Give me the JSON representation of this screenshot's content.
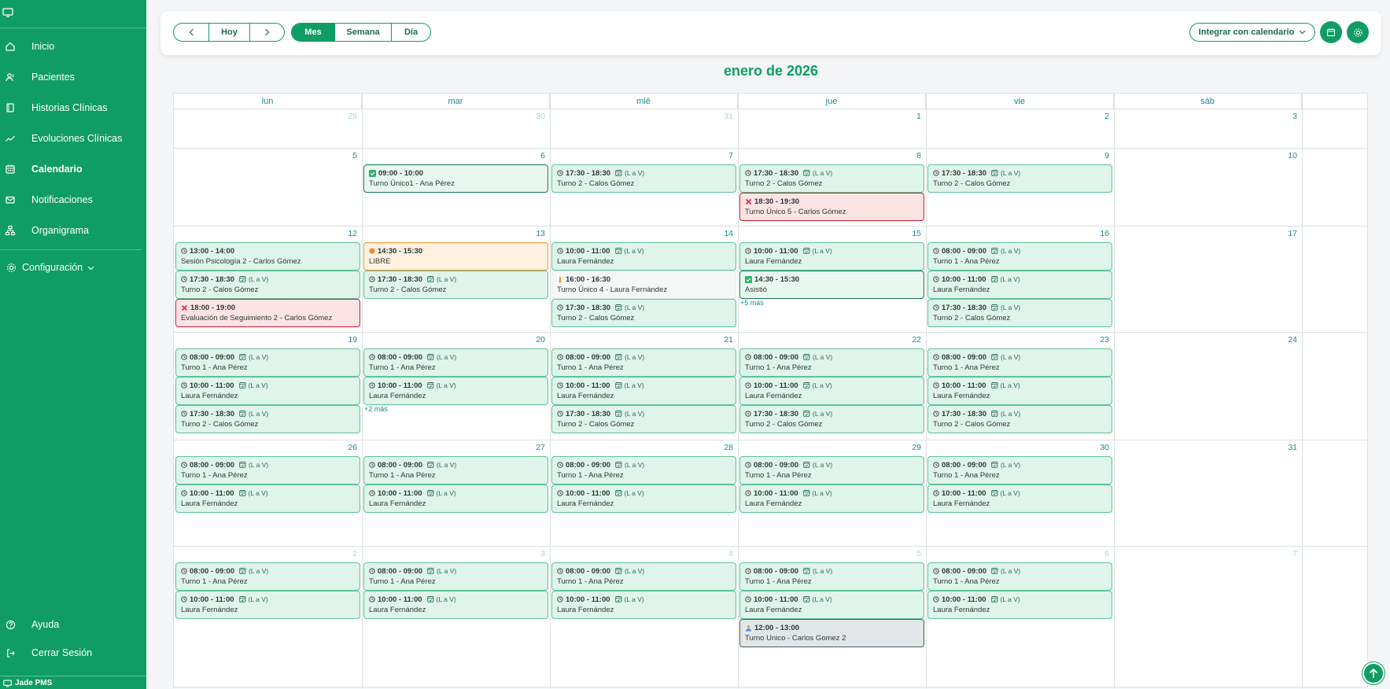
{
  "sidebar": {
    "items": [
      {
        "label": "Inicio",
        "icon": "home-icon"
      },
      {
        "label": "Pacientes",
        "icon": "users-icon"
      },
      {
        "label": "Historias Clínicas",
        "icon": "book-icon"
      },
      {
        "label": "Evoluciones Clínicas",
        "icon": "trend-icon"
      },
      {
        "label": "Calendario",
        "icon": "calendar-icon",
        "active": true
      },
      {
        "label": "Notificaciones",
        "icon": "mail-icon"
      },
      {
        "label": "Organigrama",
        "icon": "org-chart-icon"
      }
    ],
    "config_label": "Configuración",
    "help_label": "Ayuda",
    "logout_label": "Cerrar Sesión",
    "brand": "Jade PMS"
  },
  "toolbar": {
    "today_label": "Hoy",
    "views": [
      {
        "label": "Mes",
        "active": true
      },
      {
        "label": "Semana",
        "active": false
      },
      {
        "label": "Día",
        "active": false
      }
    ],
    "integrate_label": "Integrar con calendario"
  },
  "calendar": {
    "title": "enero de 2026",
    "weekdays": [
      "lun",
      "mar",
      "mié",
      "jue",
      "vie",
      "sáb"
    ],
    "weeks": [
      [
        "29",
        "30",
        "31",
        "1",
        "2",
        "3"
      ],
      [
        "5",
        "6",
        "7",
        "8",
        "9",
        "10"
      ],
      [
        "12",
        "13",
        "14",
        "15",
        "16",
        "17"
      ],
      [
        "19",
        "20",
        "21",
        "22",
        "23",
        "24"
      ],
      [
        "26",
        "27",
        "28",
        "29",
        "30",
        "31"
      ],
      [
        "2",
        "3",
        "4",
        "5",
        "6",
        "7"
      ]
    ],
    "outside_month": [
      [
        0,
        0
      ],
      [
        0,
        1
      ],
      [
        0,
        2
      ],
      [
        5,
        0
      ],
      [
        5,
        1
      ],
      [
        5,
        2
      ],
      [
        5,
        3
      ],
      [
        5,
        4
      ],
      [
        5,
        5
      ]
    ],
    "recurrence_label": "(L a V)",
    "events": [
      {
        "w": 1,
        "d": 1,
        "slot": 0,
        "time": "09:00 - 10:00",
        "title": "Turno Único1 - Ana Pérez",
        "status": "done",
        "rec": false
      },
      {
        "w": 1,
        "d": 2,
        "slot": 0,
        "time": "17:30 - 18:30",
        "title": "Turno 2 - Calos Gómez",
        "status": "scheduled",
        "rec": true
      },
      {
        "w": 1,
        "d": 3,
        "slot": 0,
        "time": "17:30 - 18:30",
        "title": "Turno 2 - Calos Gómez",
        "status": "scheduled",
        "rec": true
      },
      {
        "w": 1,
        "d": 3,
        "slot": 1,
        "time": "18:30 - 19:30",
        "title": "Turno Único 5 - Carlos Gómez",
        "status": "cancel",
        "rec": false
      },
      {
        "w": 1,
        "d": 4,
        "slot": 0,
        "time": "17:30 - 18:30",
        "title": "Turno 2 - Calos Gómez",
        "status": "scheduled",
        "rec": true
      },
      {
        "w": 2,
        "d": 0,
        "slot": 0,
        "time": "13:00 - 14:00",
        "title": "Sesión Psicología 2 - Carlos Gómez",
        "status": "scheduled",
        "rec": false
      },
      {
        "w": 2,
        "d": 0,
        "slot": 1,
        "time": "17:30 - 18:30",
        "title": "Turno 2 - Calos Gómez",
        "status": "scheduled",
        "rec": true
      },
      {
        "w": 2,
        "d": 0,
        "slot": 2,
        "time": "18:00 - 19:00",
        "title": "Evaluación de Seguimiento 2 - Carlos Gómez",
        "status": "cancel",
        "rec": false
      },
      {
        "w": 2,
        "d": 1,
        "slot": 0,
        "time": "14:30 - 15:30",
        "title": "LIBRE",
        "status": "pend",
        "rec": false
      },
      {
        "w": 2,
        "d": 1,
        "slot": 1,
        "time": "17:30 - 18:30",
        "title": "Turno 2 - Calos Gómez",
        "status": "scheduled",
        "rec": true
      },
      {
        "w": 2,
        "d": 2,
        "slot": 0,
        "time": "10:00 - 11:00",
        "title": "Laura Fernández",
        "status": "scheduled",
        "rec": true
      },
      {
        "w": 2,
        "d": 2,
        "slot": 1,
        "time": "16:00 - 16:30",
        "title": "Turno Único 4 - Laura Fernández",
        "status": "plain",
        "rec": false
      },
      {
        "w": 2,
        "d": 2,
        "slot": 2,
        "time": "17:30 - 18:30",
        "title": "Turno 2 - Calos Gómez",
        "status": "scheduled",
        "rec": true
      },
      {
        "w": 2,
        "d": 3,
        "slot": 0,
        "time": "10:00 - 11:00",
        "title": "Laura Fernández",
        "status": "scheduled",
        "rec": true
      },
      {
        "w": 2,
        "d": 3,
        "slot": 1,
        "time": "14:30 - 15:30",
        "title": "Asistió",
        "status": "done",
        "rec": false
      },
      {
        "w": 2,
        "d": 4,
        "slot": 0,
        "time": "08:00 - 09:00",
        "title": "Turno 1 - Ana Pérez",
        "status": "scheduled",
        "rec": true
      },
      {
        "w": 2,
        "d": 4,
        "slot": 1,
        "time": "10:00 - 11:00",
        "title": "Laura Fernández",
        "status": "scheduled",
        "rec": true
      },
      {
        "w": 2,
        "d": 4,
        "slot": 2,
        "time": "17:30 - 18:30",
        "title": "Turno 2 - Calos Gómez",
        "status": "scheduled",
        "rec": true
      },
      {
        "w": 3,
        "d": 0,
        "slot": 0,
        "time": "08:00 - 09:00",
        "title": "Turno 1 - Ana Pérez",
        "status": "scheduled",
        "rec": true
      },
      {
        "w": 3,
        "d": 0,
        "slot": 1,
        "time": "10:00 - 11:00",
        "title": "Laura Fernández",
        "status": "scheduled",
        "rec": true
      },
      {
        "w": 3,
        "d": 0,
        "slot": 2,
        "time": "17:30 - 18:30",
        "title": "Turno 2 - Calos Gómez",
        "status": "scheduled",
        "rec": true
      },
      {
        "w": 3,
        "d": 1,
        "slot": 0,
        "time": "08:00 - 09:00",
        "title": "Turno 1 - Ana Pérez",
        "status": "scheduled",
        "rec": true
      },
      {
        "w": 3,
        "d": 1,
        "slot": 1,
        "time": "10:00 - 11:00",
        "title": "Laura Fernández",
        "status": "scheduled",
        "rec": true
      },
      {
        "w": 3,
        "d": 2,
        "slot": 0,
        "time": "08:00 - 09:00",
        "title": "Turno 1 - Ana Pérez",
        "status": "scheduled",
        "rec": true
      },
      {
        "w": 3,
        "d": 2,
        "slot": 1,
        "time": "10:00 - 11:00",
        "title": "Laura Fernández",
        "status": "scheduled",
        "rec": true
      },
      {
        "w": 3,
        "d": 2,
        "slot": 2,
        "time": "17:30 - 18:30",
        "title": "Turno 2 - Calos Gómez",
        "status": "scheduled",
        "rec": true
      },
      {
        "w": 3,
        "d": 3,
        "slot": 0,
        "time": "08:00 - 09:00",
        "title": "Turno 1 - Ana Pérez",
        "status": "scheduled",
        "rec": true
      },
      {
        "w": 3,
        "d": 3,
        "slot": 1,
        "time": "10:00 - 11:00",
        "title": "Laura Fernández",
        "status": "scheduled",
        "rec": true
      },
      {
        "w": 3,
        "d": 3,
        "slot": 2,
        "time": "17:30 - 18:30",
        "title": "Turno 2 - Calos Gómez",
        "status": "scheduled",
        "rec": true
      },
      {
        "w": 3,
        "d": 4,
        "slot": 0,
        "time": "08:00 - 09:00",
        "title": "Turno 1 - Ana Pérez",
        "status": "scheduled",
        "rec": true
      },
      {
        "w": 3,
        "d": 4,
        "slot": 1,
        "time": "10:00 - 11:00",
        "title": "Laura Fernández",
        "status": "scheduled",
        "rec": true
      },
      {
        "w": 3,
        "d": 4,
        "slot": 2,
        "time": "17:30 - 18:30",
        "title": "Turno 2 - Calos Gómez",
        "status": "scheduled",
        "rec": true
      },
      {
        "w": 4,
        "d": 0,
        "slot": 0,
        "time": "08:00 - 09:00",
        "title": "Turno 1 - Ana Pérez",
        "status": "scheduled",
        "rec": true
      },
      {
        "w": 4,
        "d": 0,
        "slot": 1,
        "time": "10:00 - 11:00",
        "title": "Laura Fernández",
        "status": "scheduled",
        "rec": true
      },
      {
        "w": 4,
        "d": 1,
        "slot": 0,
        "time": "08:00 - 09:00",
        "title": "Turno 1 - Ana Pérez",
        "status": "scheduled",
        "rec": true
      },
      {
        "w": 4,
        "d": 1,
        "slot": 1,
        "time": "10:00 - 11:00",
        "title": "Laura Fernández",
        "status": "scheduled",
        "rec": true
      },
      {
        "w": 4,
        "d": 2,
        "slot": 0,
        "time": "08:00 - 09:00",
        "title": "Turno 1 - Ana Pérez",
        "status": "scheduled",
        "rec": true
      },
      {
        "w": 4,
        "d": 2,
        "slot": 1,
        "time": "10:00 - 11:00",
        "title": "Laura Fernández",
        "status": "scheduled",
        "rec": true
      },
      {
        "w": 4,
        "d": 3,
        "slot": 0,
        "time": "08:00 - 09:00",
        "title": "Turno 1 - Ana Pérez",
        "status": "scheduled",
        "rec": true
      },
      {
        "w": 4,
        "d": 3,
        "slot": 1,
        "time": "10:00 - 11:00",
        "title": "Laura Fernández",
        "status": "scheduled",
        "rec": true
      },
      {
        "w": 4,
        "d": 4,
        "slot": 0,
        "time": "08:00 - 09:00",
        "title": "Turno 1 - Ana Pérez",
        "status": "scheduled",
        "rec": true
      },
      {
        "w": 4,
        "d": 4,
        "slot": 1,
        "time": "10:00 - 11:00",
        "title": "Laura Fernández",
        "status": "scheduled",
        "rec": true
      },
      {
        "w": 5,
        "d": 0,
        "slot": 0,
        "time": "08:00 - 09:00",
        "title": "Turno 1 - Ana Pérez",
        "status": "scheduled",
        "rec": true
      },
      {
        "w": 5,
        "d": 0,
        "slot": 1,
        "time": "10:00 - 11:00",
        "title": "Laura Fernández",
        "status": "scheduled",
        "rec": true
      },
      {
        "w": 5,
        "d": 1,
        "slot": 0,
        "time": "08:00 - 09:00",
        "title": "Turno 1 - Ana Pérez",
        "status": "scheduled",
        "rec": true
      },
      {
        "w": 5,
        "d": 1,
        "slot": 1,
        "time": "10:00 - 11:00",
        "title": "Laura Fernández",
        "status": "scheduled",
        "rec": true
      },
      {
        "w": 5,
        "d": 2,
        "slot": 0,
        "time": "08:00 - 09:00",
        "title": "Turno 1 - Ana Pérez",
        "status": "scheduled",
        "rec": true
      },
      {
        "w": 5,
        "d": 2,
        "slot": 1,
        "time": "10:00 - 11:00",
        "title": "Laura Fernández",
        "status": "scheduled",
        "rec": true
      },
      {
        "w": 5,
        "d": 3,
        "slot": 0,
        "time": "08:00 - 09:00",
        "title": "Turno 1 - Ana Pérez",
        "status": "scheduled",
        "rec": true
      },
      {
        "w": 5,
        "d": 3,
        "slot": 1,
        "time": "10:00 - 11:00",
        "title": "Laura Fernández",
        "status": "scheduled",
        "rec": true
      },
      {
        "w": 5,
        "d": 3,
        "slot": 2,
        "time": "12:00 - 13:00",
        "title": "Turno Unico - Carlos Gomez 2",
        "status": "gray",
        "rec": false
      },
      {
        "w": 5,
        "d": 4,
        "slot": 0,
        "time": "08:00 - 09:00",
        "title": "Turno 1 - Ana Pérez",
        "status": "scheduled",
        "rec": true
      },
      {
        "w": 5,
        "d": 4,
        "slot": 1,
        "time": "10:00 - 11:00",
        "title": "Laura Fernández",
        "status": "scheduled",
        "rec": true
      }
    ],
    "more_links": [
      {
        "w": 2,
        "d": 3,
        "label": "+5 más"
      },
      {
        "w": 3,
        "d": 1,
        "label": "+2 más"
      }
    ]
  },
  "colors": {
    "brand": "#0f9d63",
    "scheduled_border": "#5ec396",
    "cancel_border": "#d11c2c",
    "pending_border": "#f09a3e",
    "day_number": "#1b8a8f"
  }
}
